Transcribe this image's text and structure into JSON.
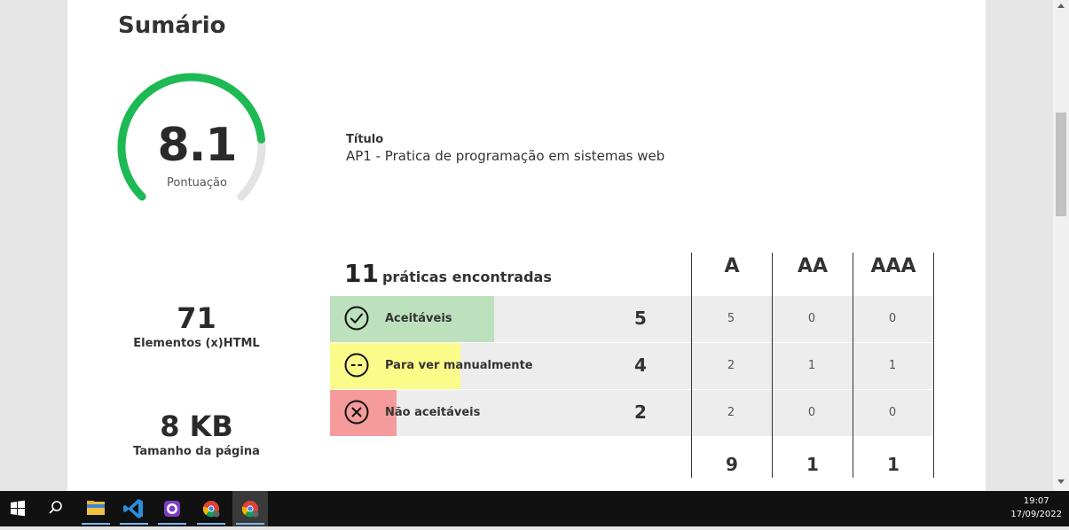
{
  "summary": {
    "title": "Sumário",
    "score": {
      "value": "8.1",
      "label": "Pontuação",
      "fraction": 0.81,
      "color": "#1db954"
    },
    "meta": {
      "label": "Título",
      "value": "AP1 - Pratica de programação em sistemas web"
    }
  },
  "stats": [
    {
      "value": "71",
      "label": "Elementos (x)HTML"
    },
    {
      "value": "8 KB",
      "label": "Tamanho da página"
    }
  ],
  "practices": {
    "count": "11",
    "label": "práticas encontradas",
    "columns": [
      "A",
      "AA",
      "AAA"
    ],
    "rows": [
      {
        "label": "Aceitáveis",
        "total": "5",
        "a": "5",
        "aa": "0",
        "aaa": "0",
        "icon": "check-circle-icon",
        "color": "#bde0bd"
      },
      {
        "label": "Para ver manualmente",
        "total": "4",
        "a": "2",
        "aa": "1",
        "aaa": "1",
        "icon": "dash-circle-icon",
        "color": "#fbfb8a"
      },
      {
        "label": "Não aceitáveis",
        "total": "2",
        "a": "2",
        "aa": "0",
        "aaa": "0",
        "icon": "x-circle-icon",
        "color": "#f59b9b"
      }
    ],
    "totals": {
      "a": "9",
      "aa": "1",
      "aaa": "1"
    }
  },
  "taskbar": {
    "apps": [
      "start-icon",
      "search-icon",
      "file-explorer-icon",
      "vscode-icon",
      "github-desktop-icon",
      "chrome-icon",
      "chrome-icon"
    ],
    "time": "19:07",
    "date": "17/09/2022"
  }
}
